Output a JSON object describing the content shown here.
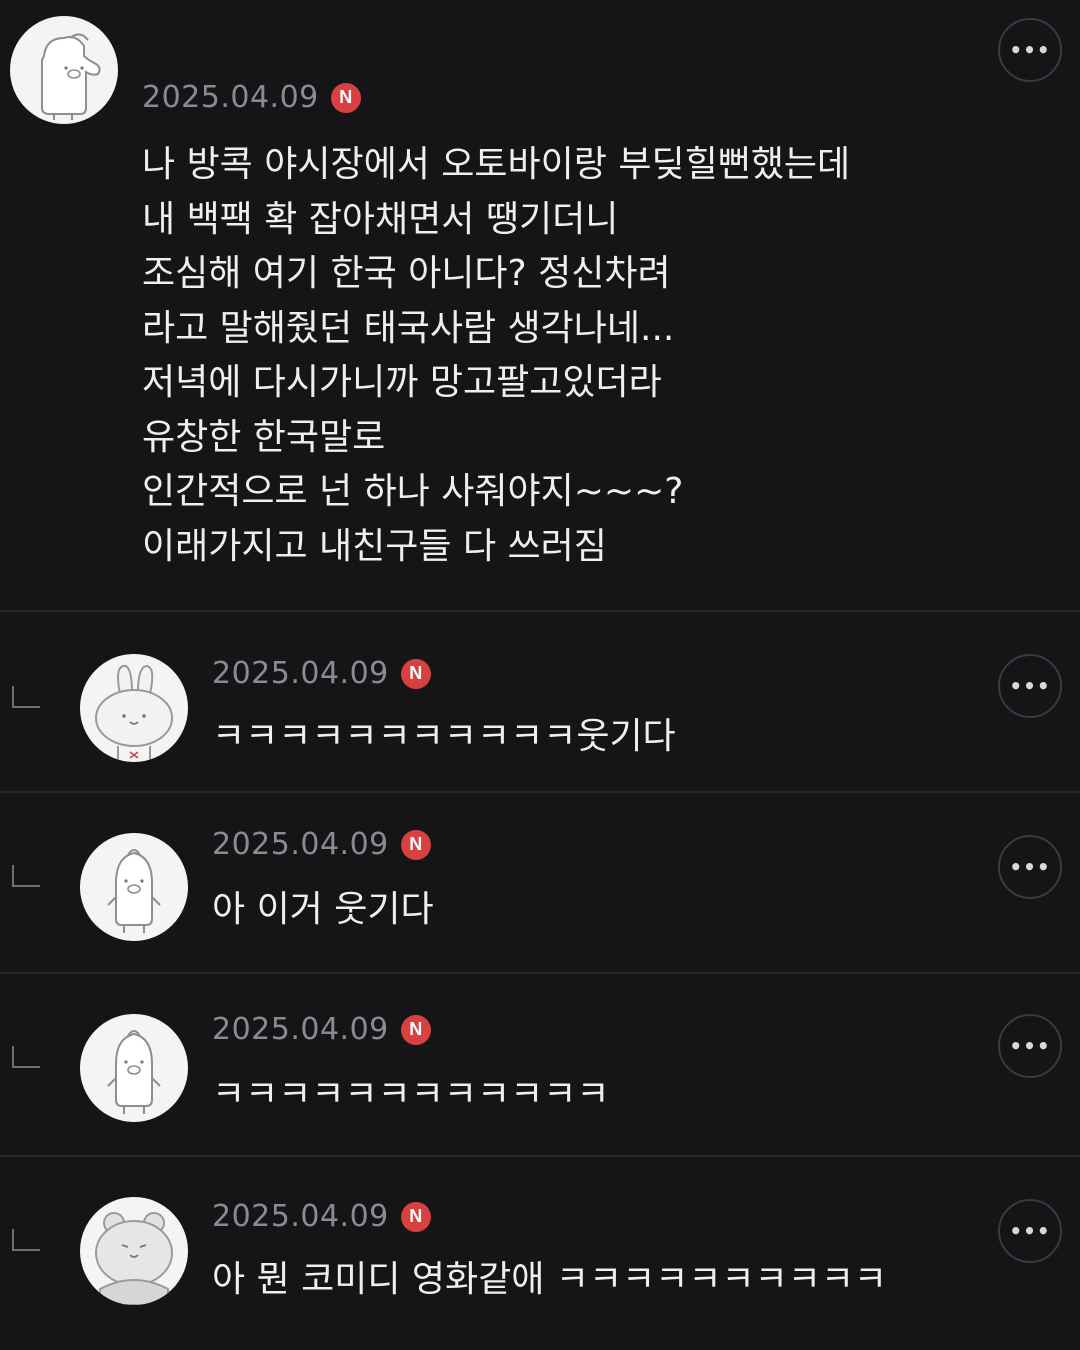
{
  "comments": [
    {
      "date": "2025.04.09",
      "badge": "N",
      "avatar_icon": "pig-character-icon",
      "lines": [
        "나 방콕 야시장에서 오토바이랑 부딪힐뻔했는데",
        "내 백팩 확 잡아채면서 땡기더니",
        "조심해 여기 한국 아니다? 정신차려",
        "라고 말해줬던 태국사람 생각나네...",
        "저녁에 다시가니까 망고팔고있더라",
        "유창한 한국말로",
        "인간적으로 넌 하나 사줘야지~~~?",
        "이래가지고 내친구들 다 쓰러짐"
      ]
    },
    {
      "date": "2025.04.09",
      "badge": "N",
      "avatar_icon": "bunny-character-icon",
      "text": "ㅋㅋㅋㅋㅋㅋㅋㅋㅋㅋㅋ웃기다"
    },
    {
      "date": "2025.04.09",
      "badge": "N",
      "avatar_icon": "pig-character-icon",
      "text": "아 이거 웃기다"
    },
    {
      "date": "2025.04.09",
      "badge": "N",
      "avatar_icon": "pig-character-icon",
      "text": "ㅋㅋㅋㅋㅋㅋㅋㅋㅋㅋㅋㅋ"
    },
    {
      "date": "2025.04.09",
      "badge": "N",
      "avatar_icon": "bear-character-icon",
      "text": "아 뭔 코미디 영화같애 ㅋㅋㅋㅋㅋㅋㅋㅋㅋㅋ"
    }
  ],
  "more_label": "•••",
  "colors": {
    "background": "#151518",
    "badge": "#d8413f",
    "date": "#8a8a90",
    "text": "#efefef",
    "divider": "#26262b"
  }
}
